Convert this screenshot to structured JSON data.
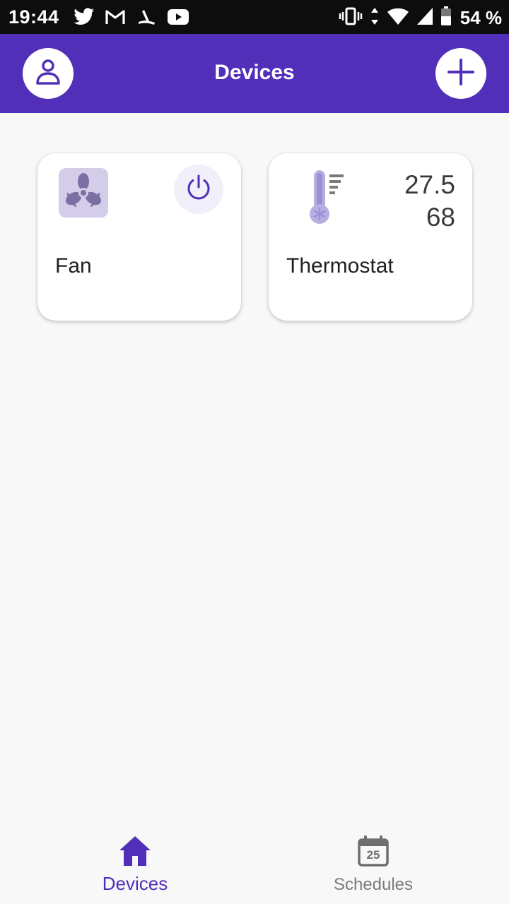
{
  "status_bar": {
    "time": "19:44",
    "battery": "54 %",
    "left_icons": [
      "twitter-icon",
      "gmail-icon",
      "strava-icon",
      "youtube-icon"
    ],
    "right_icons": [
      "vibrate-icon",
      "data-arrows-icon",
      "wifi-icon",
      "signal-icon",
      "battery-icon"
    ]
  },
  "app_bar": {
    "title": "Devices",
    "left_button_icon": "profile-icon",
    "right_button_icon": "plus-icon",
    "color": "#512fb9"
  },
  "devices": [
    {
      "name": "Fan",
      "icon": "fan-icon",
      "control_icon": "power-icon"
    },
    {
      "name": "Thermostat",
      "icon": "thermometer-icon",
      "value": "27.568"
    }
  ],
  "bottom_nav": {
    "items": [
      {
        "label": "Devices",
        "icon": "home-icon",
        "active": true
      },
      {
        "label": "Schedules",
        "icon": "calendar-icon",
        "icon_text": "25",
        "active": false
      }
    ]
  },
  "colors": {
    "accent": "#512fb9",
    "background": "#f8f8f8",
    "inactive": "#7a7a7a"
  }
}
